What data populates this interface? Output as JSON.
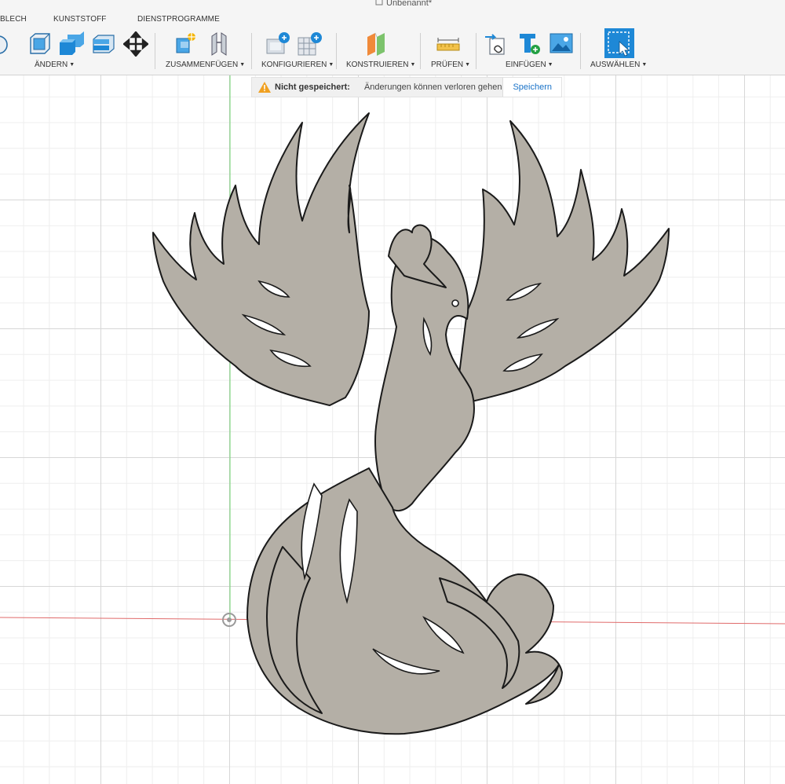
{
  "document": {
    "title": "Unbenannt*"
  },
  "tabs": [
    "BLECH",
    "KUNSTSTOFF",
    "DIENSTPROGRAMME"
  ],
  "groups": {
    "aendern": "ÄNDERN",
    "zusammenfuegen": "ZUSAMMENFÜGEN",
    "konfigurieren": "KONFIGURIEREN",
    "konstruieren": "KONSTRUIEREN",
    "pruefen": "PRÜFEN",
    "einfuegen": "EINFÜGEN",
    "auswaehlen": "AUSWÄHLEN"
  },
  "notification": {
    "status": "Nicht gespeichert:",
    "message": "Änderungen können verloren gehen",
    "action": "Speichern"
  },
  "colors": {
    "accent": "#1a73c8",
    "sketch_fill": "#b4afa6",
    "x_axis": "#e06a6a",
    "y_axis": "#6fd06f",
    "warning": "#f0a020"
  },
  "icons": [
    "press-pull-icon",
    "fillet-icon",
    "shell-icon",
    "combine-icon",
    "move-icon",
    "new-component-icon",
    "joint-icon",
    "config-table-icon",
    "config-rules-icon",
    "offset-plane-icon",
    "measure-icon",
    "insert-derive-icon",
    "insert-mcmaster-icon",
    "insert-canvas-icon",
    "select-icon"
  ]
}
